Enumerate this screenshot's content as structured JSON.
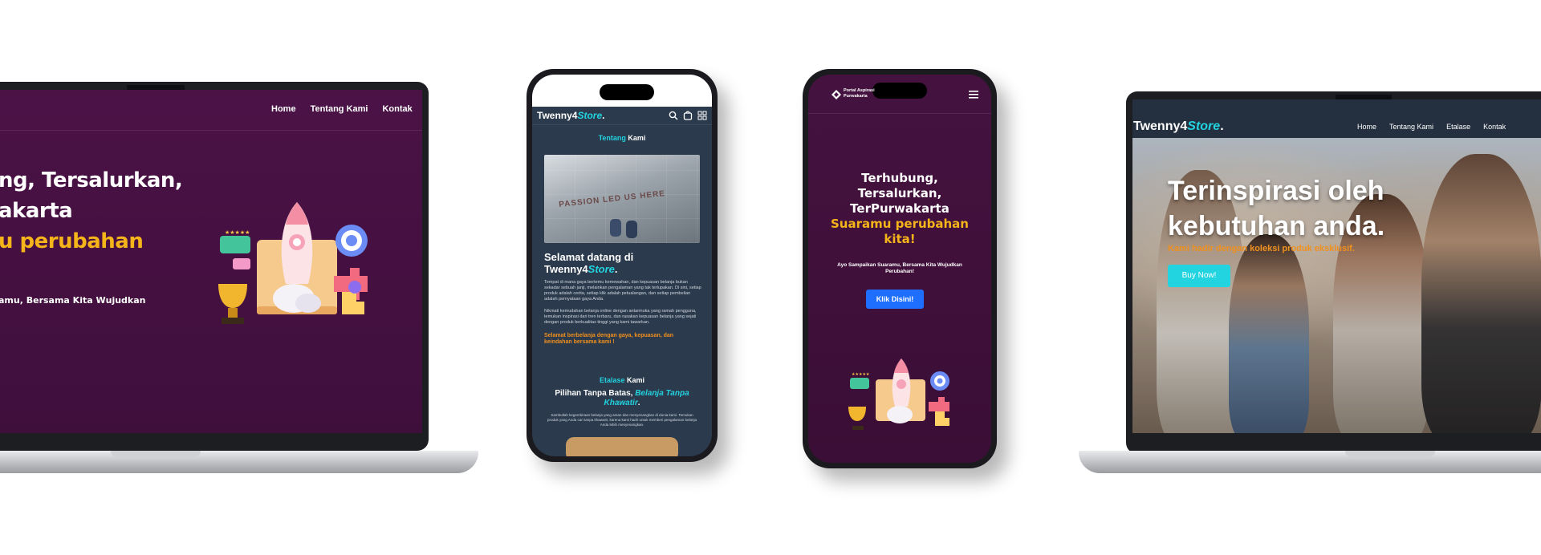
{
  "left_laptop": {
    "nav": [
      "Home",
      "Tentang Kami",
      "Kontak"
    ],
    "hero_line1": "ng, Tersalurkan,",
    "hero_line2": "akarta",
    "hero_line3": "u perubahan",
    "hero_sub": "amu, Bersama Kita Wujudkan"
  },
  "phone_about": {
    "brand_main": "Twenny4",
    "brand_accent": "Store",
    "brand_dot": ".",
    "section_title_accent": "Tentang",
    "section_title_rest": " Kami",
    "photo_caption": "PASSION LED US HERE",
    "welcome_line1": "Selamat datang di",
    "welcome_brand_main": "Twenny4",
    "welcome_brand_accent": "Store",
    "welcome_dot": ".",
    "para1": "Tempat di mana gaya bertemu kemewahan, dan kepuasan belanja bukan sekadar sebuah janji, melainkan pengalaman yang tak terlupakan. Di sini, setiap produk adalah cerita, setiap klik adalah petualangan, dan setiap pembelian adalah pernyataan gaya Anda.",
    "para2": "Nikmati kemudahan belanja online dengan antarmuka yang ramah pengguna, temukan inspirasi dari tren terbaru, dan rasakan kepuasan belanja yang sejati dengan produk berkualitas tinggi yang kami tawarkan.",
    "closing": "Selamat berbelanja dengan gaya, kepuasan, dan keindahan bersama kami !",
    "etalase_accent": "Etalase",
    "etalase_rest": " Kami",
    "pilihan_main": "Pilihan Tanpa Batas, ",
    "pilihan_accent": "Belanja Tanpa Khawatir",
    "pilihan_dot": ".",
    "small_para": "Sambutlah kegembiraan belanja yang aman dan menyenangkan di dunia kami. Temukan produk yang Anda cari tanpa khawatir, karena kami hadir untuk memberi pengalaman belanja Anda lebih menyenangkan."
  },
  "phone_portal": {
    "logo_line1": "Portal Aspirasi",
    "logo_line2": "Purwakarta",
    "hero_line1": "Terhubung,",
    "hero_line2": "Tersalurkan,",
    "hero_line3": "TerPurwakarta",
    "hero_yellow1": "Suaramu perubahan",
    "hero_yellow2": "kita!",
    "sub_line1": "Ayo Sampaikan Suaramu, Bersama Kita Wujudkan",
    "sub_line2": "Perubahan!",
    "cta": "Klik Disini!"
  },
  "right_laptop": {
    "brand_main": "Twenny4",
    "brand_accent": "Store",
    "brand_dot": ".",
    "nav": [
      "Home",
      "Tentang Kami",
      "Etalase",
      "Kontak"
    ],
    "hero_line1": "Terinspirasi oleh",
    "hero_line2": "kebutuhan anda.",
    "hero_sub": "Kami hadir dengan koleksi produk eksklusif.",
    "cta": "Buy Now!"
  },
  "colors": {
    "purple": "#4b1246",
    "yellow": "#f4b41a",
    "cyan": "#22d3e0",
    "navy": "#2b3a4c",
    "blue_button": "#1f6fff",
    "orange": "#f0901e"
  }
}
